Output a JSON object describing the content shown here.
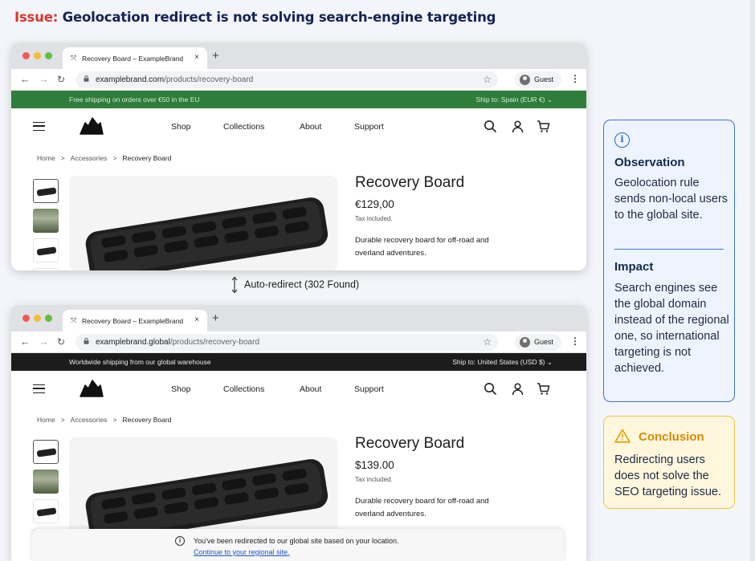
{
  "issue": {
    "label": "Issue:",
    "text": "Geolocation redirect is not solving search-engine targeting"
  },
  "browser_top": {
    "tab_title": "Recovery Board – ExampleBrand",
    "tab_close": "×",
    "new_tab": "+",
    "url_domain": "examplebrand.com",
    "url_path": "/products/recovery-board",
    "guest": "Guest",
    "announce_left": "Free shipping on orders over €50 in the EU",
    "announce_right": "Ship to: Spain (EUR €) ⌄",
    "announce_color": "#2e7d3a",
    "nav": {
      "shop": "Shop",
      "collections": "Collections",
      "about": "About",
      "support": "Support"
    },
    "breadcrumb": {
      "home": "Home",
      "sep": ">",
      "accessories": "Accessories",
      "current": "Recovery Board"
    },
    "product": {
      "name": "Recovery Board",
      "price": "€129,00",
      "tax": "Tax included.",
      "desc": "Durable recovery board for off-road and overland adventures."
    }
  },
  "redirect_label": "Auto-redirect (302 Found)",
  "browser_bottom": {
    "tab_title": "Recovery Board – ExampleBrand",
    "tab_close": "×",
    "new_tab": "+",
    "url_domain": "examplebrand.global",
    "url_path": "/products/recovery-board",
    "guest": "Guest",
    "announce_left": "Worldwide shipping from our global warehouse",
    "announce_right": "Ship to: United States (USD $) ⌄",
    "announce_color": "#1c1c1c",
    "nav": {
      "shop": "Shop",
      "collections": "Collections",
      "about": "About",
      "support": "Support"
    },
    "breadcrumb": {
      "home": "Home",
      "sep": ">",
      "accessories": "Accessories",
      "current": "Recovery Board"
    },
    "product": {
      "name": "Recovery Board",
      "price": "$139.00",
      "tax": "Tax included.",
      "desc": "Durable recovery board for off-road and overland adventures."
    },
    "notice": {
      "text": "You've been redirected to our global site based on your location.",
      "link": "Continue to your regional site."
    }
  },
  "observation": {
    "icon": "info-icon",
    "title": "Observation",
    "text": "Geolocation rule sends non-local users to the global site.",
    "impact_title": "Impact",
    "impact_text": "Search engines see the global domain instead of the regional one, so international targeting is not achieved."
  },
  "conclusion": {
    "icon": "warning-icon",
    "title": "Conclusion",
    "text": "Redirecting users does not solve the SEO targeting issue."
  },
  "colors": {
    "issue_red": "#d43a2b",
    "title_navy": "#142452",
    "info_blue": "#3b74d4",
    "warn_amber": "#f1c343"
  }
}
